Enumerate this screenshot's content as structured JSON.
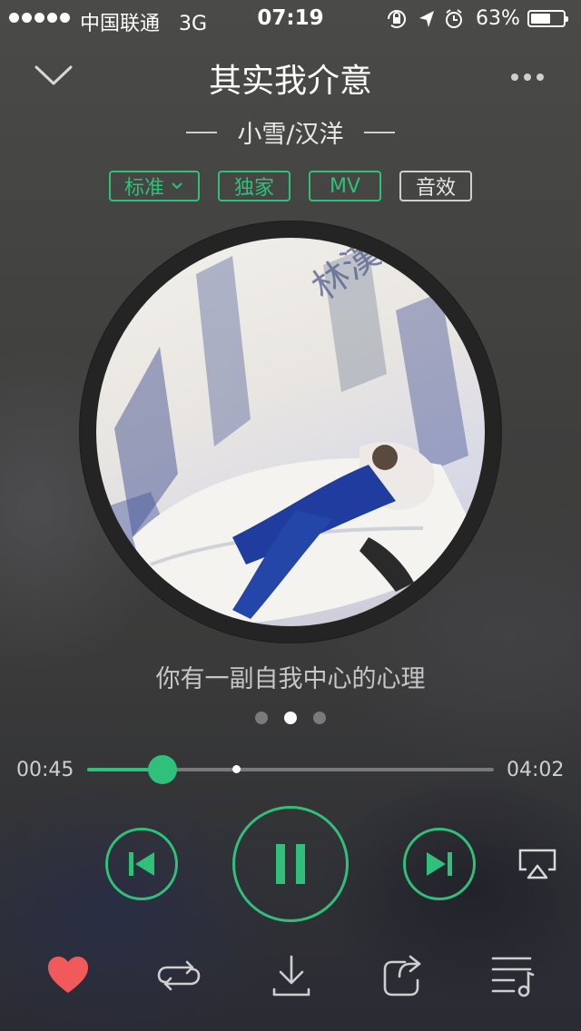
{
  "status_bar": {
    "carrier": "中国联通",
    "network": "3G",
    "time": "07:19",
    "battery": "63%",
    "battery_level": 0.63,
    "icons": [
      "orientation-lock-icon",
      "location-arrow-icon",
      "alarm-icon"
    ]
  },
  "header": {
    "collapse_icon": "chevron-down-icon",
    "more_icon": "more-dots-icon",
    "title": "其实我介意",
    "artist": "小雪/汉洋"
  },
  "tags": {
    "quality": "标准",
    "exclusive": "独家",
    "mv": "MV",
    "effects": "音效"
  },
  "album": {
    "overlay_text": "林漢洋"
  },
  "lyric": {
    "current_line": "你有一副自我中心的心理",
    "page_count": 3,
    "active_page": 2
  },
  "progress": {
    "current_time": "00:45",
    "total_time": "04:02",
    "played_fraction": 0.186,
    "buffered_fraction": 0.366
  },
  "controls": {
    "prev_icon": "skip-previous-icon",
    "play_state": "playing",
    "play_icon": "pause-icon",
    "next_icon": "skip-next-icon",
    "airplay_icon": "airplay-icon"
  },
  "bottom_bar": {
    "items": [
      "heart-icon",
      "repeat-icon",
      "download-icon",
      "share-icon",
      "playlist-icon"
    ]
  },
  "colors": {
    "accent": "#2fc07a",
    "favorite": "#f05a5a"
  }
}
